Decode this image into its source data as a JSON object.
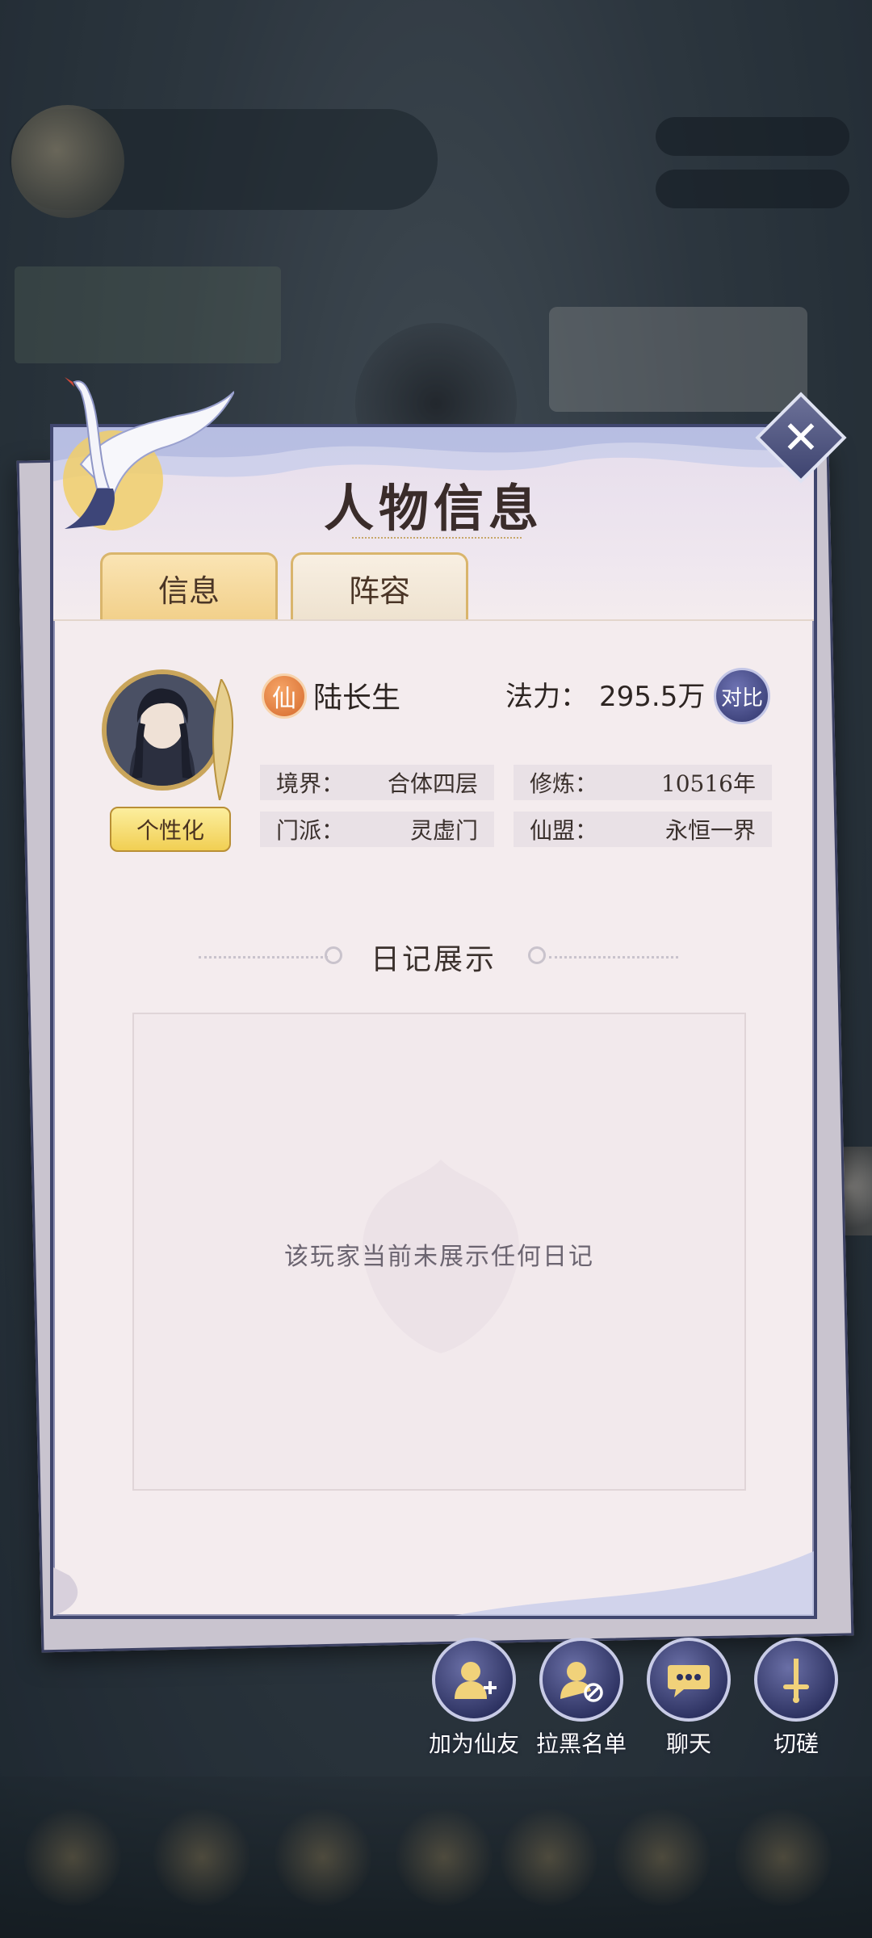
{
  "dialog": {
    "title": "人物信息",
    "close_glyph": "✕"
  },
  "tabs": [
    {
      "label": "信息",
      "active": true
    },
    {
      "label": "阵容",
      "active": false
    }
  ],
  "profile": {
    "badge": "仙",
    "name": "陆长生",
    "power_label": "法力：",
    "power_value": "295.5万",
    "compare_label": "对比",
    "customize_label": "个性化",
    "fields": [
      {
        "label": "境界：",
        "value": "合体四层"
      },
      {
        "label": "修炼：",
        "value": "10516年"
      },
      {
        "label": "门派：",
        "value": "灵虚门"
      },
      {
        "label": "仙盟：",
        "value": "永恒一界"
      }
    ]
  },
  "diary": {
    "title": "日记展示",
    "empty_text": "该玩家当前未展示任何日记"
  },
  "actions": [
    {
      "label": "加为仙友",
      "icon": "add-friend-icon"
    },
    {
      "label": "拉黑名单",
      "icon": "block-user-icon"
    },
    {
      "label": "聊天",
      "icon": "chat-icon"
    },
    {
      "label": "切磋",
      "icon": "sword-icon"
    }
  ],
  "colors": {
    "dialog_bg": "#f4ecee",
    "dialog_border": "#40466e",
    "tab_active": "#f2d08a",
    "accent_gold": "#c9a55b",
    "button_blue": "#2c3160"
  }
}
